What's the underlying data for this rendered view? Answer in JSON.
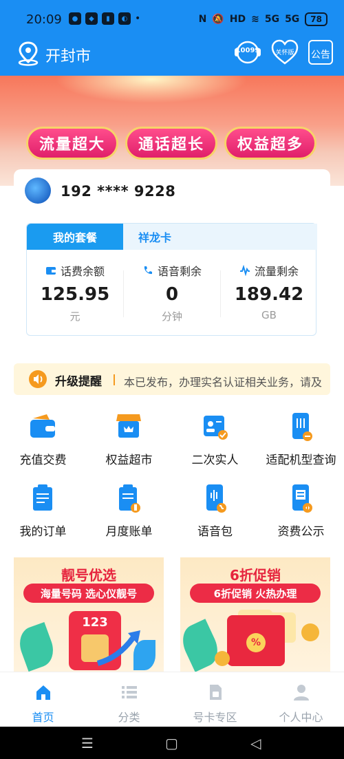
{
  "status_bar": {
    "time": "20:09",
    "battery": "78",
    "signal_1": "5G",
    "signal_2": "5G",
    "hd": "HD"
  },
  "header": {
    "city": "开封市",
    "hotline": "10099",
    "care_mode": "关怀版",
    "notice": "公告"
  },
  "banner": {
    "pills": [
      "流量超大",
      "通话超长",
      "权益超多"
    ]
  },
  "account": {
    "phone": "192 **** 9228",
    "tabs": {
      "active": "我的套餐",
      "other": "祥龙卡"
    },
    "metrics": [
      {
        "label": "话费余额",
        "value": "125.95",
        "unit": "元",
        "icon": "wallet-icon"
      },
      {
        "label": "语音剩余",
        "value": "0",
        "unit": "分钟",
        "icon": "phone-icon"
      },
      {
        "label": "流量剩余",
        "value": "189.42",
        "unit": "GB",
        "icon": "wave-icon"
      }
    ]
  },
  "upgrade": {
    "title": "升级提醒",
    "text": "本已发布，办理实名认证相关业务，请及"
  },
  "grid": [
    {
      "label": "充值交费",
      "icon": "wallet-icon"
    },
    {
      "label": "权益超市",
      "icon": "shop-icon"
    },
    {
      "label": "二次实人",
      "icon": "id-card-icon"
    },
    {
      "label": "适配机型查询",
      "icon": "phone-settings-icon"
    },
    {
      "label": "我的订单",
      "icon": "clipboard-icon"
    },
    {
      "label": "月度账单",
      "icon": "bill-icon"
    },
    {
      "label": "语音包",
      "icon": "voice-pack-icon"
    },
    {
      "label": "资费公示",
      "icon": "tariff-icon"
    }
  ],
  "promos": [
    {
      "title": "靓号优选",
      "subtitle": "海量号码 选心仪靓号",
      "sim_text": "123"
    },
    {
      "title": "6折促销",
      "subtitle": "6折促销 火热办理",
      "badge": "%"
    }
  ],
  "bottom_nav": [
    {
      "label": "首页",
      "icon": "home-icon"
    },
    {
      "label": "分类",
      "icon": "list-icon"
    },
    {
      "label": "号卡专区",
      "icon": "sim-card-icon"
    },
    {
      "label": "个人中心",
      "icon": "user-icon"
    }
  ],
  "colors": {
    "primary": "#1a8ef3",
    "accent_red": "#e6243e",
    "warning": "#f59a1f"
  }
}
